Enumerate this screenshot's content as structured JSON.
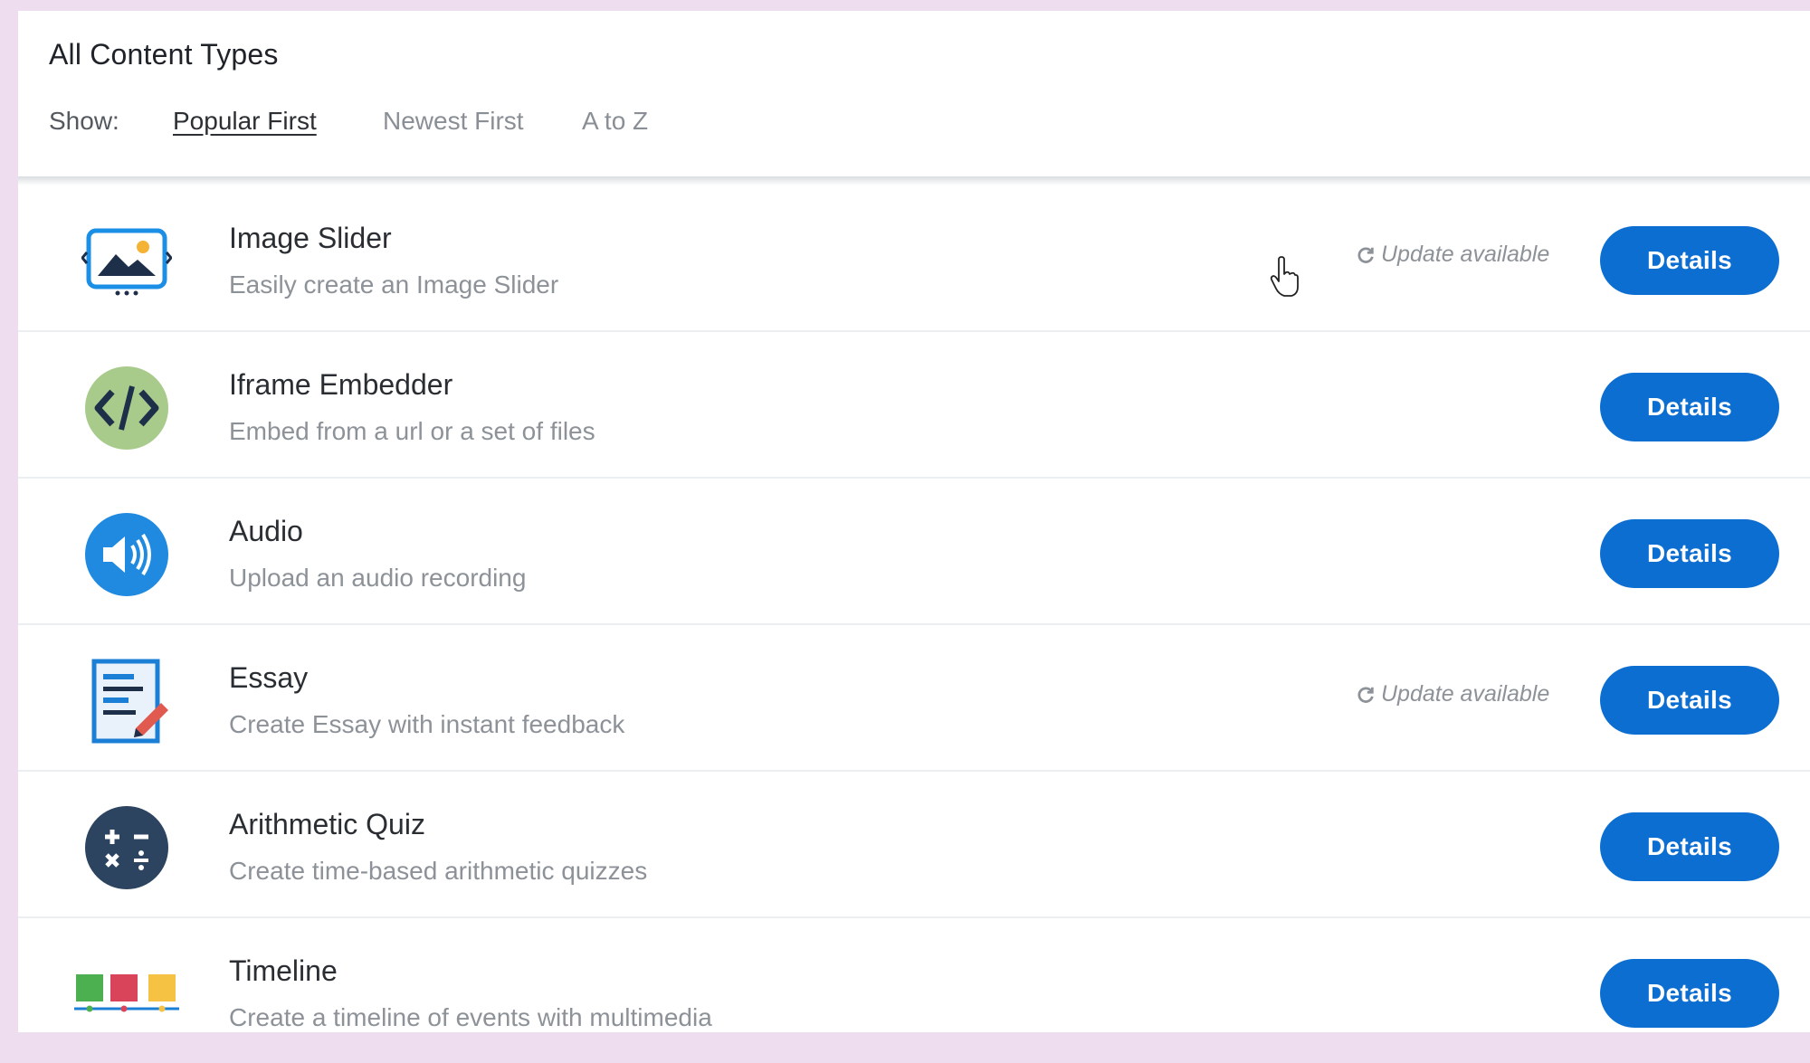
{
  "header": {
    "title": "All Content Types",
    "show_label": "Show:",
    "sort_options": [
      "Popular First",
      "Newest First",
      "A to Z"
    ],
    "active_sort": "Popular First"
  },
  "items": [
    {
      "title": "Image Slider",
      "description": "Easily create an Image Slider",
      "update": "Update available",
      "button": "Details",
      "icon": "image-slider-icon"
    },
    {
      "title": "Iframe Embedder",
      "description": "Embed from a url or a set of files",
      "update": "",
      "button": "Details",
      "icon": "code-icon"
    },
    {
      "title": "Audio",
      "description": "Upload an audio recording",
      "update": "",
      "button": "Details",
      "icon": "speaker-icon"
    },
    {
      "title": "Essay",
      "description": "Create Essay with instant feedback",
      "update": "Update available",
      "button": "Details",
      "icon": "essay-icon"
    },
    {
      "title": "Arithmetic Quiz",
      "description": "Create time-based arithmetic quizzes",
      "update": "",
      "button": "Details",
      "icon": "calculator-icon"
    },
    {
      "title": "Timeline",
      "description": "Create a timeline of events with multimedia",
      "update": "",
      "button": "Details",
      "icon": "timeline-icon"
    }
  ],
  "colors": {
    "accent": "#0d6ed1",
    "background": "#eedcef"
  }
}
